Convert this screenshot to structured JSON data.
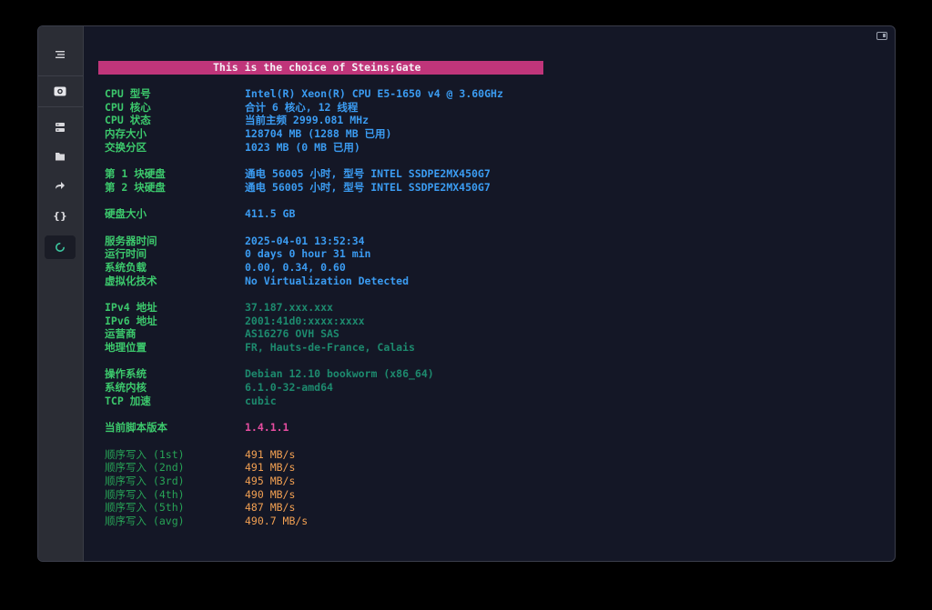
{
  "sidebar": {
    "icons": [
      "menu-icon",
      "camera-icon",
      "server-icon",
      "folder-icon",
      "forward-icon",
      "braces-icon",
      "gauge-icon"
    ]
  },
  "terminal": {
    "banner": "This is the choice of Steins;Gate",
    "hardware": [
      {
        "label": "CPU 型号",
        "value": "Intel(R) Xeon(R) CPU E5-1650 v4 @ 3.60GHz"
      },
      {
        "label": "CPU 核心",
        "value": "合计 6 核心, 12 线程"
      },
      {
        "label": "CPU 状态",
        "value": "当前主频 2999.081 MHz"
      },
      {
        "label": "内存大小",
        "value": "128704 MB (1288 MB 已用)"
      },
      {
        "label": "交换分区",
        "value": "1023 MB (0 MB 已用)"
      }
    ],
    "disks": [
      {
        "label": "第 1 块硬盘",
        "value": "通电 56005 小时, 型号 INTEL SSDPE2MX450G7"
      },
      {
        "label": "第 2 块硬盘",
        "value": "通电 56005 小时, 型号 INTEL SSDPE2MX450G7"
      }
    ],
    "disk_size": {
      "label": "硬盘大小",
      "value": "411.5 GB"
    },
    "system": [
      {
        "label": "服务器时间",
        "value": "2025-04-01 13:52:34"
      },
      {
        "label": "运行时间",
        "value": "0 days 0 hour 31 min"
      },
      {
        "label": "系统负载",
        "value": "0.00, 0.34, 0.60"
      },
      {
        "label": "虚拟化技术",
        "value": "No Virtualization Detected"
      }
    ],
    "network": [
      {
        "label": "IPv4 地址",
        "value": "37.187.xxx.xxx"
      },
      {
        "label": "IPv6 地址",
        "value": "2001:41d0:xxxx:xxxx"
      },
      {
        "label": "运营商",
        "value": "AS16276 OVH SAS"
      },
      {
        "label": "地理位置",
        "value": "FR, Hauts-de-France, Calais"
      }
    ],
    "os": [
      {
        "label": "操作系统",
        "value": "Debian 12.10 bookworm (x86_64)"
      },
      {
        "label": "系统内核",
        "value": "6.1.0-32-amd64"
      },
      {
        "label": "TCP 加速",
        "value": "cubic"
      }
    ],
    "script_version": {
      "label": "当前脚本版本",
      "value": "1.4.1.1"
    },
    "writes": [
      {
        "label": "顺序写入 (1st)",
        "value": "491 MB/s"
      },
      {
        "label": "顺序写入 (2nd)",
        "value": "491 MB/s"
      },
      {
        "label": "顺序写入 (3rd)",
        "value": "495 MB/s"
      },
      {
        "label": "顺序写入 (4th)",
        "value": "490 MB/s"
      },
      {
        "label": "顺序写入 (5th)",
        "value": "487 MB/s"
      },
      {
        "label": "顺序写入 (avg)",
        "value": "490.7 MB/s"
      }
    ]
  },
  "colors": {
    "banner_bg": "#c0357a",
    "label_green": "#3cc86c",
    "value_blue": "#3b9cf2",
    "value_teal": "#1d8a6e",
    "value_pink": "#e64da0",
    "value_orange": "#f2a052"
  }
}
